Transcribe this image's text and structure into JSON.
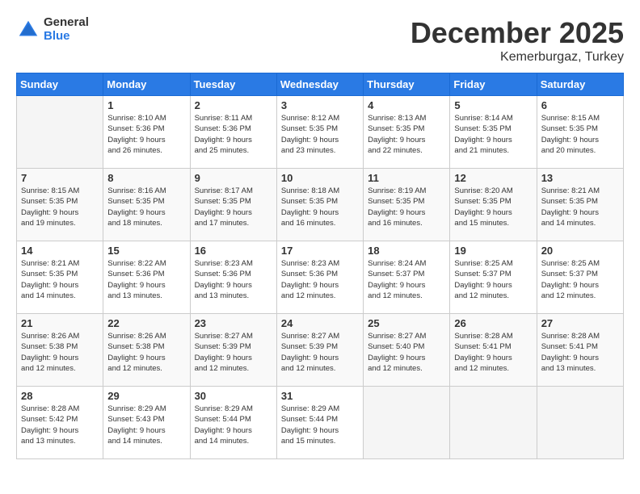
{
  "logo": {
    "general": "General",
    "blue": "Blue"
  },
  "title": "December 2025",
  "location": "Kemerburgaz, Turkey",
  "weekdays": [
    "Sunday",
    "Monday",
    "Tuesday",
    "Wednesday",
    "Thursday",
    "Friday",
    "Saturday"
  ],
  "weeks": [
    [
      {
        "day": "",
        "info": ""
      },
      {
        "day": "1",
        "info": "Sunrise: 8:10 AM\nSunset: 5:36 PM\nDaylight: 9 hours\nand 26 minutes."
      },
      {
        "day": "2",
        "info": "Sunrise: 8:11 AM\nSunset: 5:36 PM\nDaylight: 9 hours\nand 25 minutes."
      },
      {
        "day": "3",
        "info": "Sunrise: 8:12 AM\nSunset: 5:35 PM\nDaylight: 9 hours\nand 23 minutes."
      },
      {
        "day": "4",
        "info": "Sunrise: 8:13 AM\nSunset: 5:35 PM\nDaylight: 9 hours\nand 22 minutes."
      },
      {
        "day": "5",
        "info": "Sunrise: 8:14 AM\nSunset: 5:35 PM\nDaylight: 9 hours\nand 21 minutes."
      },
      {
        "day": "6",
        "info": "Sunrise: 8:15 AM\nSunset: 5:35 PM\nDaylight: 9 hours\nand 20 minutes."
      }
    ],
    [
      {
        "day": "7",
        "info": "Sunrise: 8:15 AM\nSunset: 5:35 PM\nDaylight: 9 hours\nand 19 minutes."
      },
      {
        "day": "8",
        "info": "Sunrise: 8:16 AM\nSunset: 5:35 PM\nDaylight: 9 hours\nand 18 minutes."
      },
      {
        "day": "9",
        "info": "Sunrise: 8:17 AM\nSunset: 5:35 PM\nDaylight: 9 hours\nand 17 minutes."
      },
      {
        "day": "10",
        "info": "Sunrise: 8:18 AM\nSunset: 5:35 PM\nDaylight: 9 hours\nand 16 minutes."
      },
      {
        "day": "11",
        "info": "Sunrise: 8:19 AM\nSunset: 5:35 PM\nDaylight: 9 hours\nand 16 minutes."
      },
      {
        "day": "12",
        "info": "Sunrise: 8:20 AM\nSunset: 5:35 PM\nDaylight: 9 hours\nand 15 minutes."
      },
      {
        "day": "13",
        "info": "Sunrise: 8:21 AM\nSunset: 5:35 PM\nDaylight: 9 hours\nand 14 minutes."
      }
    ],
    [
      {
        "day": "14",
        "info": "Sunrise: 8:21 AM\nSunset: 5:35 PM\nDaylight: 9 hours\nand 14 minutes."
      },
      {
        "day": "15",
        "info": "Sunrise: 8:22 AM\nSunset: 5:36 PM\nDaylight: 9 hours\nand 13 minutes."
      },
      {
        "day": "16",
        "info": "Sunrise: 8:23 AM\nSunset: 5:36 PM\nDaylight: 9 hours\nand 13 minutes."
      },
      {
        "day": "17",
        "info": "Sunrise: 8:23 AM\nSunset: 5:36 PM\nDaylight: 9 hours\nand 12 minutes."
      },
      {
        "day": "18",
        "info": "Sunrise: 8:24 AM\nSunset: 5:37 PM\nDaylight: 9 hours\nand 12 minutes."
      },
      {
        "day": "19",
        "info": "Sunrise: 8:25 AM\nSunset: 5:37 PM\nDaylight: 9 hours\nand 12 minutes."
      },
      {
        "day": "20",
        "info": "Sunrise: 8:25 AM\nSunset: 5:37 PM\nDaylight: 9 hours\nand 12 minutes."
      }
    ],
    [
      {
        "day": "21",
        "info": "Sunrise: 8:26 AM\nSunset: 5:38 PM\nDaylight: 9 hours\nand 12 minutes."
      },
      {
        "day": "22",
        "info": "Sunrise: 8:26 AM\nSunset: 5:38 PM\nDaylight: 9 hours\nand 12 minutes."
      },
      {
        "day": "23",
        "info": "Sunrise: 8:27 AM\nSunset: 5:39 PM\nDaylight: 9 hours\nand 12 minutes."
      },
      {
        "day": "24",
        "info": "Sunrise: 8:27 AM\nSunset: 5:39 PM\nDaylight: 9 hours\nand 12 minutes."
      },
      {
        "day": "25",
        "info": "Sunrise: 8:27 AM\nSunset: 5:40 PM\nDaylight: 9 hours\nand 12 minutes."
      },
      {
        "day": "26",
        "info": "Sunrise: 8:28 AM\nSunset: 5:41 PM\nDaylight: 9 hours\nand 12 minutes."
      },
      {
        "day": "27",
        "info": "Sunrise: 8:28 AM\nSunset: 5:41 PM\nDaylight: 9 hours\nand 13 minutes."
      }
    ],
    [
      {
        "day": "28",
        "info": "Sunrise: 8:28 AM\nSunset: 5:42 PM\nDaylight: 9 hours\nand 13 minutes."
      },
      {
        "day": "29",
        "info": "Sunrise: 8:29 AM\nSunset: 5:43 PM\nDaylight: 9 hours\nand 14 minutes."
      },
      {
        "day": "30",
        "info": "Sunrise: 8:29 AM\nSunset: 5:44 PM\nDaylight: 9 hours\nand 14 minutes."
      },
      {
        "day": "31",
        "info": "Sunrise: 8:29 AM\nSunset: 5:44 PM\nDaylight: 9 hours\nand 15 minutes."
      },
      {
        "day": "",
        "info": ""
      },
      {
        "day": "",
        "info": ""
      },
      {
        "day": "",
        "info": ""
      }
    ]
  ]
}
